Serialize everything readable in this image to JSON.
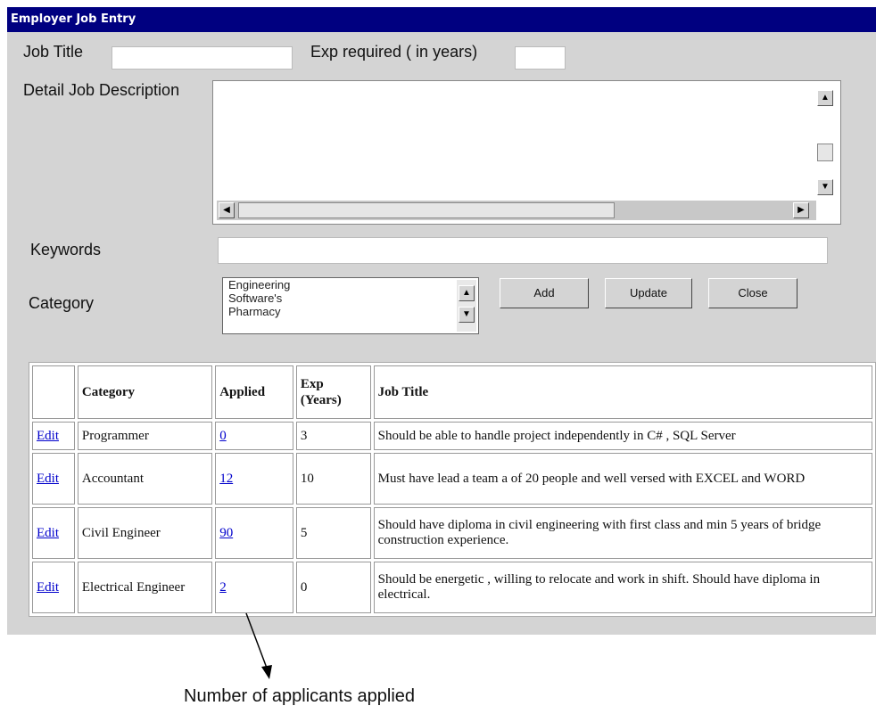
{
  "window": {
    "title": "Employer Job Entry"
  },
  "form": {
    "job_title_label": "Job Title",
    "job_title_value": "",
    "exp_label": "Exp required ( in years)",
    "exp_value": "",
    "description_label": "Detail Job Description",
    "description_value": "",
    "keywords_label": "Keywords",
    "keywords_value": "",
    "category_label": "Category",
    "category_options": [
      "Engineering",
      "Software's",
      "Pharmacy"
    ]
  },
  "buttons": {
    "add": "Add",
    "update": "Update",
    "close": "Close"
  },
  "table": {
    "headers": [
      "",
      "Category",
      "Applied",
      "Exp\n(Years)",
      "Job Title"
    ],
    "rows": [
      {
        "action": "Edit",
        "category": "Programmer",
        "applied": "0",
        "exp": "3",
        "job_title": "Should be able to handle project independently in C# , SQL Server"
      },
      {
        "action": "Edit",
        "category": "Accountant",
        "applied": "12",
        "exp": "10",
        "job_title": "Must have lead a team a of 20 people and well versed with EXCEL and WORD"
      },
      {
        "action": "Edit",
        "category": "Civil Engineer",
        "applied": "90",
        "exp": "5",
        "job_title": "Should have diploma in civil engineering with first class and min 5 years of bridge construction experience."
      },
      {
        "action": "Edit",
        "category": "Electrical Engineer",
        "applied": "2",
        "exp": "0",
        "job_title": "Should be energetic , willing to relocate and work in shift. Should have diploma in electrical."
      }
    ]
  },
  "annotation": {
    "text": "Number of applicants applied"
  }
}
